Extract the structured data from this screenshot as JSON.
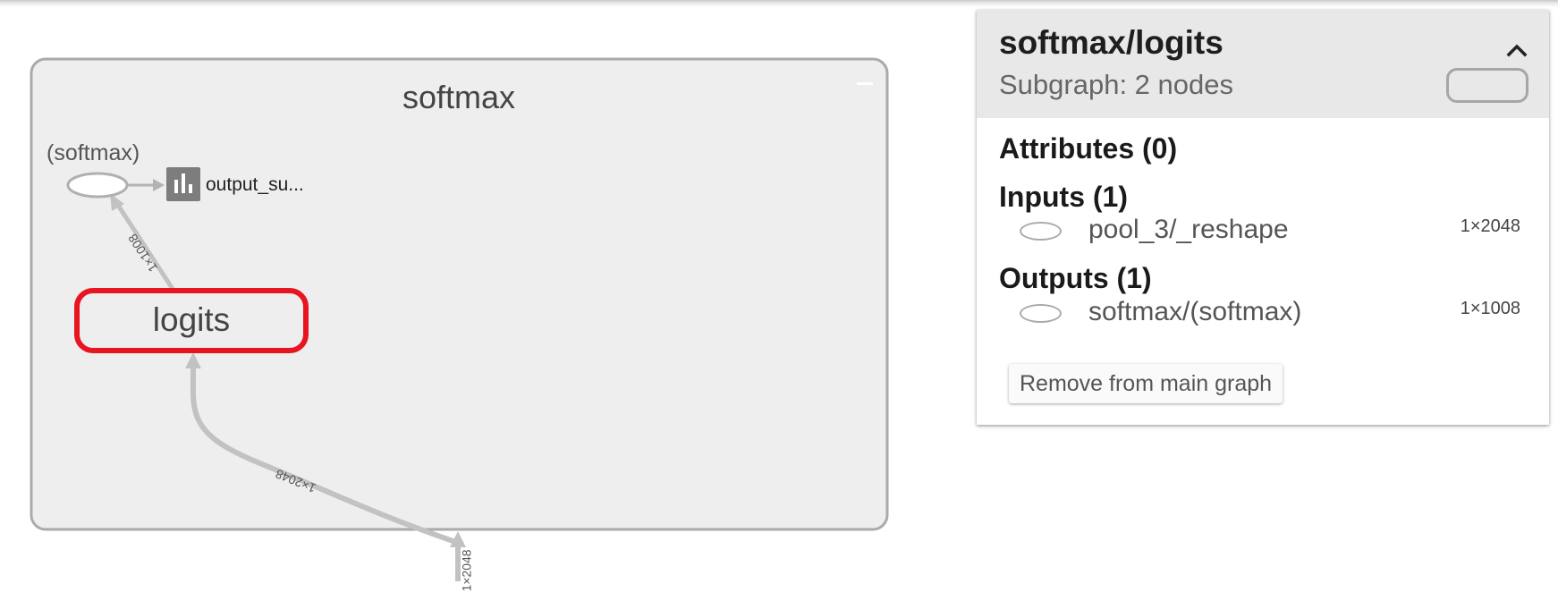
{
  "graph": {
    "scope_title": "softmax",
    "op_node_label": "(softmax)",
    "summary_node_label": "output_su...",
    "summary_icon": "bar-chart-icon",
    "selected_node_label": "logits",
    "edge_logits_to_softmax": "1×1008",
    "edge_input_to_logits": "1×2048",
    "edge_offscreen_input": "1×2048",
    "selection_color": "#e8141f"
  },
  "info_card": {
    "title": "softmax/logits",
    "subtitle": "Subgraph: 2 nodes",
    "collapse_icon": "chevron-up-icon",
    "attributes_heading": "Attributes (0)",
    "inputs_heading": "Inputs (1)",
    "inputs": [
      {
        "name": "pool_3/_reshape",
        "shape": "1×2048"
      }
    ],
    "outputs_heading": "Outputs (1)",
    "outputs": [
      {
        "name": "softmax/(softmax)",
        "shape": "1×1008"
      }
    ],
    "remove_button_label": "Remove from main graph"
  }
}
